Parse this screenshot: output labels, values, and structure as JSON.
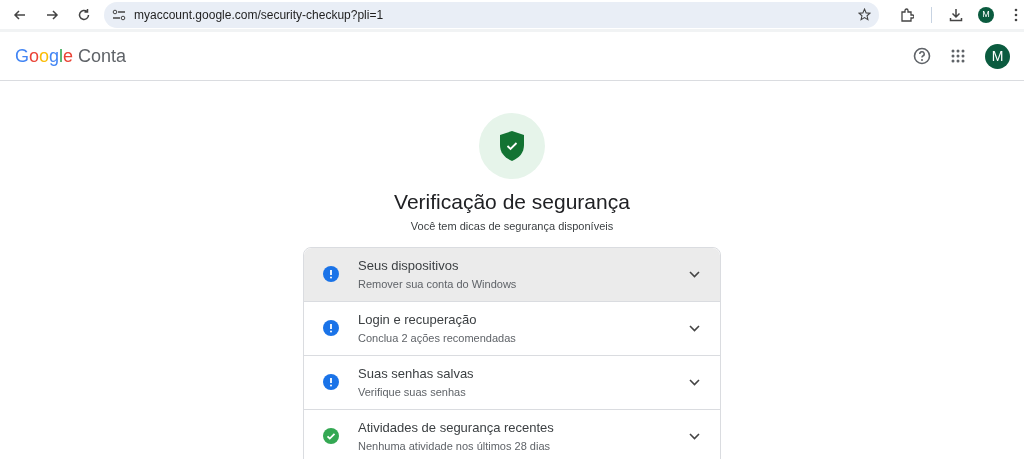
{
  "browser": {
    "url": "myaccount.google.com/security-checkup?pli=1",
    "profile_initial": "M"
  },
  "header": {
    "logo_word": "Google",
    "product": "Conta",
    "avatar_initial": "M"
  },
  "hero": {
    "title": "Verificação de segurança",
    "subtitle": "Você tem dicas de segurança disponíveis"
  },
  "items": [
    {
      "kind": "warning",
      "title": "Seus dispositivos",
      "subtitle": "Remover sua conta do Windows",
      "highlighted": true
    },
    {
      "kind": "warning",
      "title": "Login e recuperação",
      "subtitle": "Conclua 2 ações recomendadas",
      "highlighted": false
    },
    {
      "kind": "warning",
      "title": "Suas senhas salvas",
      "subtitle": "Verifique suas senhas",
      "highlighted": false
    },
    {
      "kind": "ok",
      "title": "Atividades de segurança recentes",
      "subtitle": "Nenhuma atividade nos últimos 28 dias",
      "highlighted": false
    }
  ]
}
